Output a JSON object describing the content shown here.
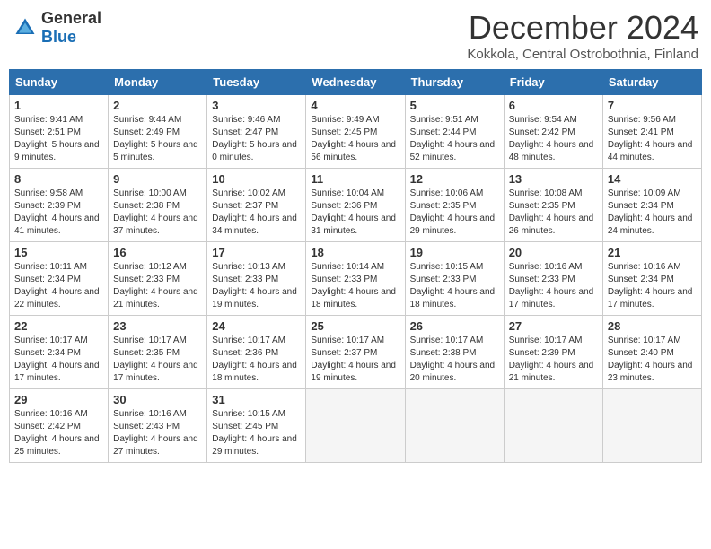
{
  "header": {
    "logo_general": "General",
    "logo_blue": "Blue",
    "month_title": "December 2024",
    "location": "Kokkola, Central Ostrobothnia, Finland"
  },
  "days_of_week": [
    "Sunday",
    "Monday",
    "Tuesday",
    "Wednesday",
    "Thursday",
    "Friday",
    "Saturday"
  ],
  "weeks": [
    [
      {
        "day": 1,
        "sunrise": "9:41 AM",
        "sunset": "2:51 PM",
        "daylight": "5 hours and 9 minutes."
      },
      {
        "day": 2,
        "sunrise": "9:44 AM",
        "sunset": "2:49 PM",
        "daylight": "5 hours and 5 minutes."
      },
      {
        "day": 3,
        "sunrise": "9:46 AM",
        "sunset": "2:47 PM",
        "daylight": "5 hours and 0 minutes."
      },
      {
        "day": 4,
        "sunrise": "9:49 AM",
        "sunset": "2:45 PM",
        "daylight": "4 hours and 56 minutes."
      },
      {
        "day": 5,
        "sunrise": "9:51 AM",
        "sunset": "2:44 PM",
        "daylight": "4 hours and 52 minutes."
      },
      {
        "day": 6,
        "sunrise": "9:54 AM",
        "sunset": "2:42 PM",
        "daylight": "4 hours and 48 minutes."
      },
      {
        "day": 7,
        "sunrise": "9:56 AM",
        "sunset": "2:41 PM",
        "daylight": "4 hours and 44 minutes."
      }
    ],
    [
      {
        "day": 8,
        "sunrise": "9:58 AM",
        "sunset": "2:39 PM",
        "daylight": "4 hours and 41 minutes."
      },
      {
        "day": 9,
        "sunrise": "10:00 AM",
        "sunset": "2:38 PM",
        "daylight": "4 hours and 37 minutes."
      },
      {
        "day": 10,
        "sunrise": "10:02 AM",
        "sunset": "2:37 PM",
        "daylight": "4 hours and 34 minutes."
      },
      {
        "day": 11,
        "sunrise": "10:04 AM",
        "sunset": "2:36 PM",
        "daylight": "4 hours and 31 minutes."
      },
      {
        "day": 12,
        "sunrise": "10:06 AM",
        "sunset": "2:35 PM",
        "daylight": "4 hours and 29 minutes."
      },
      {
        "day": 13,
        "sunrise": "10:08 AM",
        "sunset": "2:35 PM",
        "daylight": "4 hours and 26 minutes."
      },
      {
        "day": 14,
        "sunrise": "10:09 AM",
        "sunset": "2:34 PM",
        "daylight": "4 hours and 24 minutes."
      }
    ],
    [
      {
        "day": 15,
        "sunrise": "10:11 AM",
        "sunset": "2:34 PM",
        "daylight": "4 hours and 22 minutes."
      },
      {
        "day": 16,
        "sunrise": "10:12 AM",
        "sunset": "2:33 PM",
        "daylight": "4 hours and 21 minutes."
      },
      {
        "day": 17,
        "sunrise": "10:13 AM",
        "sunset": "2:33 PM",
        "daylight": "4 hours and 19 minutes."
      },
      {
        "day": 18,
        "sunrise": "10:14 AM",
        "sunset": "2:33 PM",
        "daylight": "4 hours and 18 minutes."
      },
      {
        "day": 19,
        "sunrise": "10:15 AM",
        "sunset": "2:33 PM",
        "daylight": "4 hours and 18 minutes."
      },
      {
        "day": 20,
        "sunrise": "10:16 AM",
        "sunset": "2:33 PM",
        "daylight": "4 hours and 17 minutes."
      },
      {
        "day": 21,
        "sunrise": "10:16 AM",
        "sunset": "2:34 PM",
        "daylight": "4 hours and 17 minutes."
      }
    ],
    [
      {
        "day": 22,
        "sunrise": "10:17 AM",
        "sunset": "2:34 PM",
        "daylight": "4 hours and 17 minutes."
      },
      {
        "day": 23,
        "sunrise": "10:17 AM",
        "sunset": "2:35 PM",
        "daylight": "4 hours and 17 minutes."
      },
      {
        "day": 24,
        "sunrise": "10:17 AM",
        "sunset": "2:36 PM",
        "daylight": "4 hours and 18 minutes."
      },
      {
        "day": 25,
        "sunrise": "10:17 AM",
        "sunset": "2:37 PM",
        "daylight": "4 hours and 19 minutes."
      },
      {
        "day": 26,
        "sunrise": "10:17 AM",
        "sunset": "2:38 PM",
        "daylight": "4 hours and 20 minutes."
      },
      {
        "day": 27,
        "sunrise": "10:17 AM",
        "sunset": "2:39 PM",
        "daylight": "4 hours and 21 minutes."
      },
      {
        "day": 28,
        "sunrise": "10:17 AM",
        "sunset": "2:40 PM",
        "daylight": "4 hours and 23 minutes."
      }
    ],
    [
      {
        "day": 29,
        "sunrise": "10:16 AM",
        "sunset": "2:42 PM",
        "daylight": "4 hours and 25 minutes."
      },
      {
        "day": 30,
        "sunrise": "10:16 AM",
        "sunset": "2:43 PM",
        "daylight": "4 hours and 27 minutes."
      },
      {
        "day": 31,
        "sunrise": "10:15 AM",
        "sunset": "2:45 PM",
        "daylight": "4 hours and 29 minutes."
      },
      null,
      null,
      null,
      null
    ]
  ]
}
